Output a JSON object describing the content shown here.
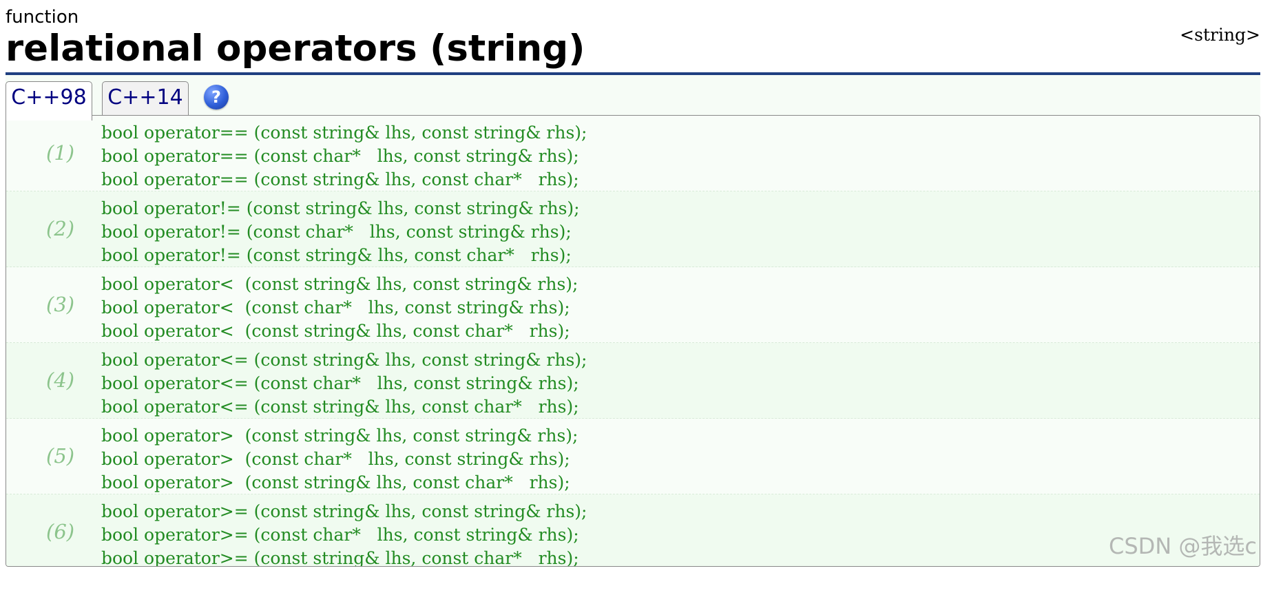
{
  "header": {
    "kind": "function",
    "title": "relational operators (string)",
    "header_tag": "<string>"
  },
  "tabs": [
    {
      "label": "C++98",
      "active": true
    },
    {
      "label": "C++14",
      "active": false
    }
  ],
  "help": {
    "icon": "help-icon",
    "glyph": "?"
  },
  "groups": [
    {
      "number": "(1)",
      "lines": [
        "bool operator== (const string& lhs, const string& rhs);",
        "bool operator== (const char*   lhs, const string& rhs);",
        "bool operator== (const string& lhs, const char*   rhs);"
      ]
    },
    {
      "number": "(2)",
      "lines": [
        "bool operator!= (const string& lhs, const string& rhs);",
        "bool operator!= (const char*   lhs, const string& rhs);",
        "bool operator!= (const string& lhs, const char*   rhs);"
      ]
    },
    {
      "number": "(3)",
      "lines": [
        "bool operator<  (const string& lhs, const string& rhs);",
        "bool operator<  (const char*   lhs, const string& rhs);",
        "bool operator<  (const string& lhs, const char*   rhs);"
      ]
    },
    {
      "number": "(4)",
      "lines": [
        "bool operator<= (const string& lhs, const string& rhs);",
        "bool operator<= (const char*   lhs, const string& rhs);",
        "bool operator<= (const string& lhs, const char*   rhs);"
      ]
    },
    {
      "number": "(5)",
      "lines": [
        "bool operator>  (const string& lhs, const string& rhs);",
        "bool operator>  (const char*   lhs, const string& rhs);",
        "bool operator>  (const string& lhs, const char*   rhs);"
      ]
    },
    {
      "number": "(6)",
      "lines": [
        "bool operator>= (const string& lhs, const string& rhs);",
        "bool operator>= (const char*   lhs, const string& rhs);",
        "bool operator>= (const string& lhs, const char*   rhs);"
      ]
    }
  ],
  "watermark": "CSDN @我选c",
  "colors": {
    "rule": "#1f3f80",
    "code": "#228b22",
    "group_number": "#8cc48c",
    "tab_text": "#000080",
    "background": "#f8fdf8"
  }
}
